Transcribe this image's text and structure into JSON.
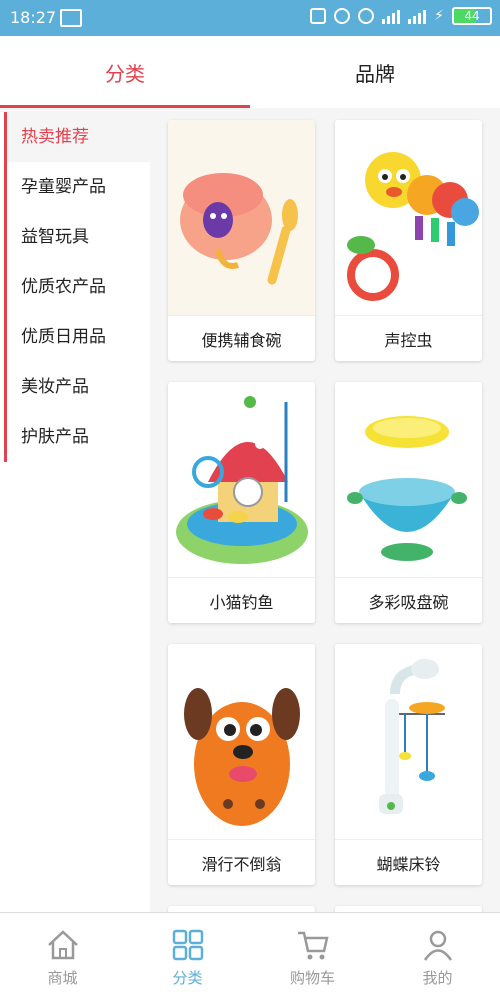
{
  "status_bar": {
    "time": "18:27",
    "battery": "44"
  },
  "top_tabs": [
    {
      "label": "分类",
      "active": true
    },
    {
      "label": "品牌",
      "active": false
    }
  ],
  "sidebar": {
    "items": [
      {
        "label": "热卖推荐",
        "active": true
      },
      {
        "label": "孕童婴产品"
      },
      {
        "label": "益智玩具"
      },
      {
        "label": "优质农产品"
      },
      {
        "label": "优质日用品"
      },
      {
        "label": "美妆产品"
      },
      {
        "label": "护肤产品"
      }
    ]
  },
  "products": [
    {
      "name": "便携辅食碗",
      "icon": "baby-bowl-icon"
    },
    {
      "name": "声控虫",
      "icon": "caterpillar-toy-icon"
    },
    {
      "name": "小猫钓鱼",
      "icon": "fishing-toy-icon"
    },
    {
      "name": "多彩吸盘碗",
      "icon": "suction-bowl-icon"
    },
    {
      "name": "滑行不倒翁",
      "icon": "dog-tumbler-icon"
    },
    {
      "name": "蝴蝶床铃",
      "icon": "crib-mobile-icon"
    }
  ],
  "bottom_nav": [
    {
      "label": "商城",
      "icon": "home-icon",
      "active": false
    },
    {
      "label": "分类",
      "icon": "grid-icon",
      "active": true
    },
    {
      "label": "购物车",
      "icon": "cart-icon",
      "active": false
    },
    {
      "label": "我的",
      "icon": "user-icon",
      "active": false
    }
  ],
  "colors": {
    "accent": "#e2414f",
    "status_bar": "#5cafd8",
    "nav_active": "#5cafd8"
  }
}
